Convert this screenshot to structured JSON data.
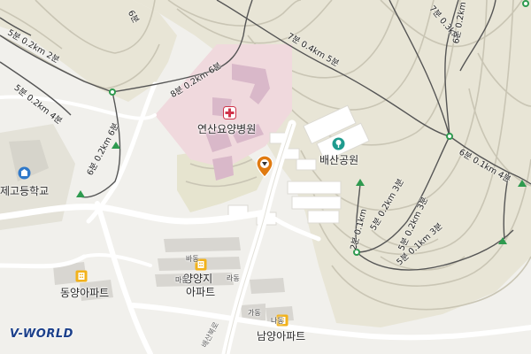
{
  "places": {
    "hospital": "연산요양병원",
    "park": "배산공원",
    "school": "제고등학교",
    "apt_dongyang": "동양아파트",
    "apt_yangji": "양양지",
    "apt_yangji_2": "아파트",
    "apt_namyang": "남양아파트"
  },
  "buildings": {
    "ba": "바동",
    "ma": "마동",
    "ra": "라동",
    "ga": "가동",
    "na": "나동"
  },
  "road": "배산북로",
  "routes": {
    "r1": "5분 0.2km 2분",
    "r2": "5분 0.2km 4분",
    "r3": "6분 0.2km 6분",
    "r4": "8분 0.2km 6분",
    "r5": "7분 0.4km 5분",
    "r6": "6분",
    "r7": "7분 0.3km",
    "r8": "6분 0.2km",
    "r9": "6분 0.1km 4분",
    "r10": "2분 0.1km",
    "r11": "5분 0.2km 3분",
    "r12": "5분 0.2km 3분",
    "r13": "5분 0.1km 3분"
  },
  "logo": "V-WORLD",
  "colors": {
    "hospital_zone": "#f0d9dd",
    "hospital_building": "#d9b8c9",
    "hill": "#e8e5d6",
    "contour": "#c9c5b4",
    "trail": "#555555",
    "node": "#2e9a4f",
    "poi_yellow": "#f2b21b",
    "poi_teal": "#1f9b8e",
    "pin": "#e07a10",
    "school_blue": "#2f78c9"
  },
  "icons": {
    "hospital": "hospital-cross-icon",
    "park": "park-icon",
    "school": "school-icon",
    "apartment": "apartment-icon",
    "location": "location-pin-icon"
  }
}
